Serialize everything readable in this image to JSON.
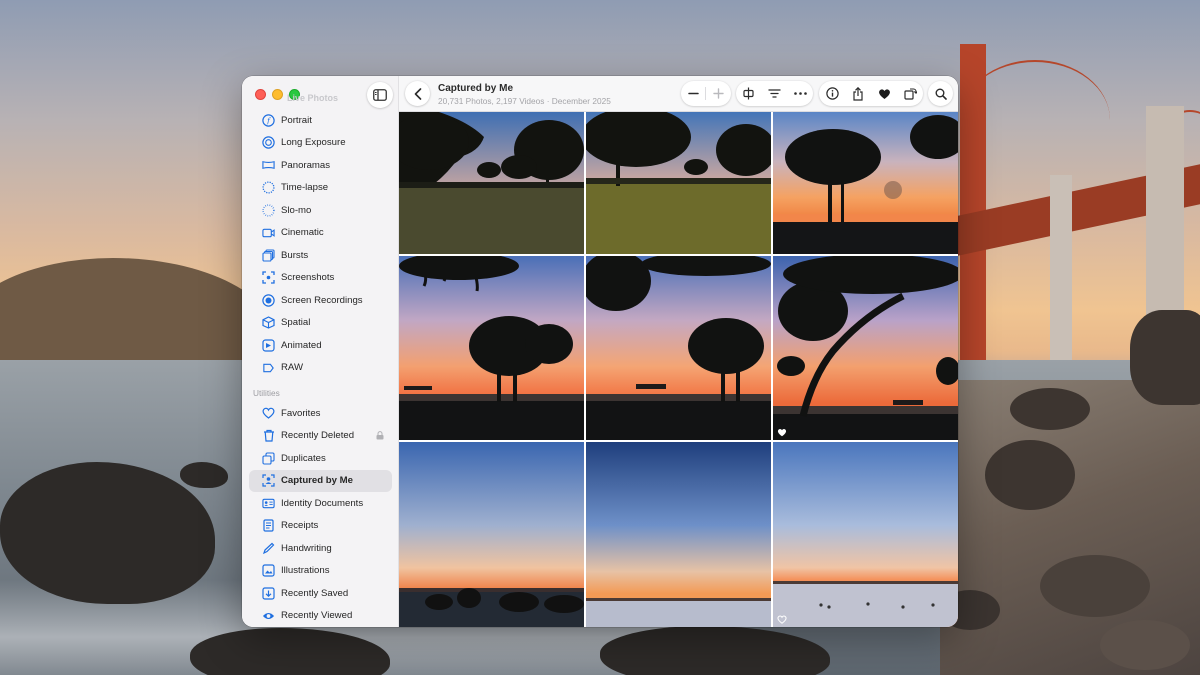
{
  "window": {
    "sidebar_faded_heading": "Live Photos",
    "album_title": "Captured by Me",
    "album_subtitle": "20,731 Photos, 2,197 Videos · December 2025"
  },
  "sidebar": {
    "media_types": [
      {
        "label": "Portrait",
        "icon": "portrait-icon"
      },
      {
        "label": "Long Exposure",
        "icon": "long-exposure-icon"
      },
      {
        "label": "Panoramas",
        "icon": "panorama-icon"
      },
      {
        "label": "Time-lapse",
        "icon": "timelapse-icon"
      },
      {
        "label": "Slo-mo",
        "icon": "slomo-icon"
      },
      {
        "label": "Cinematic",
        "icon": "cinematic-icon"
      },
      {
        "label": "Bursts",
        "icon": "bursts-icon"
      },
      {
        "label": "Screenshots",
        "icon": "screenshot-icon"
      },
      {
        "label": "Screen Recordings",
        "icon": "screen-recording-icon"
      },
      {
        "label": "Spatial",
        "icon": "spatial-icon"
      },
      {
        "label": "Animated",
        "icon": "animated-icon"
      },
      {
        "label": "RAW",
        "icon": "raw-icon"
      }
    ],
    "utilities_heading": "Utilities",
    "utilities": [
      {
        "label": "Favorites",
        "icon": "heart-icon"
      },
      {
        "label": "Recently Deleted",
        "icon": "trash-icon"
      },
      {
        "label": "Duplicates",
        "icon": "duplicates-icon"
      },
      {
        "label": "Captured by Me",
        "icon": "captured-by-me-icon"
      },
      {
        "label": "Identity Documents",
        "icon": "id-card-icon"
      },
      {
        "label": "Receipts",
        "icon": "receipt-icon"
      },
      {
        "label": "Handwriting",
        "icon": "pen-icon"
      },
      {
        "label": "Illustrations",
        "icon": "illustrations-icon"
      },
      {
        "label": "Recently Saved",
        "icon": "recently-saved-icon"
      },
      {
        "label": "Recently Viewed",
        "icon": "eye-icon"
      }
    ],
    "active_item": "Captured by Me"
  },
  "toolbar": {
    "zoom_out_icon": "minus-icon",
    "zoom_in_icon": "plus-icon",
    "buttons": [
      "slideshow-icon",
      "filter-icon",
      "more-icon",
      "info-icon",
      "share-icon",
      "favorite-icon",
      "rotate-icon",
      "search-icon"
    ]
  },
  "photos": [
    {
      "scene": "dusk-trees",
      "favorite": false
    },
    {
      "scene": "dusk-trees-lit",
      "favorite": false
    },
    {
      "scene": "sunset-single-tree",
      "favorite": false
    },
    {
      "scene": "sunset-oak-pier",
      "favorite": false
    },
    {
      "scene": "sunset-oak-pier-2",
      "favorite": false
    },
    {
      "scene": "sunset-oak-branch",
      "favorite": true
    },
    {
      "scene": "twilight-horizon-trees",
      "favorite": false
    },
    {
      "scene": "twilight-sky",
      "favorite": false
    },
    {
      "scene": "twilight-horizon-birds",
      "favorite": true
    }
  ],
  "colors": {
    "accent": "#1f6fe0",
    "sky_top": "#1e3f78",
    "sunset_orange": "#f08a4b",
    "favorite_heart": "#ffffff"
  }
}
